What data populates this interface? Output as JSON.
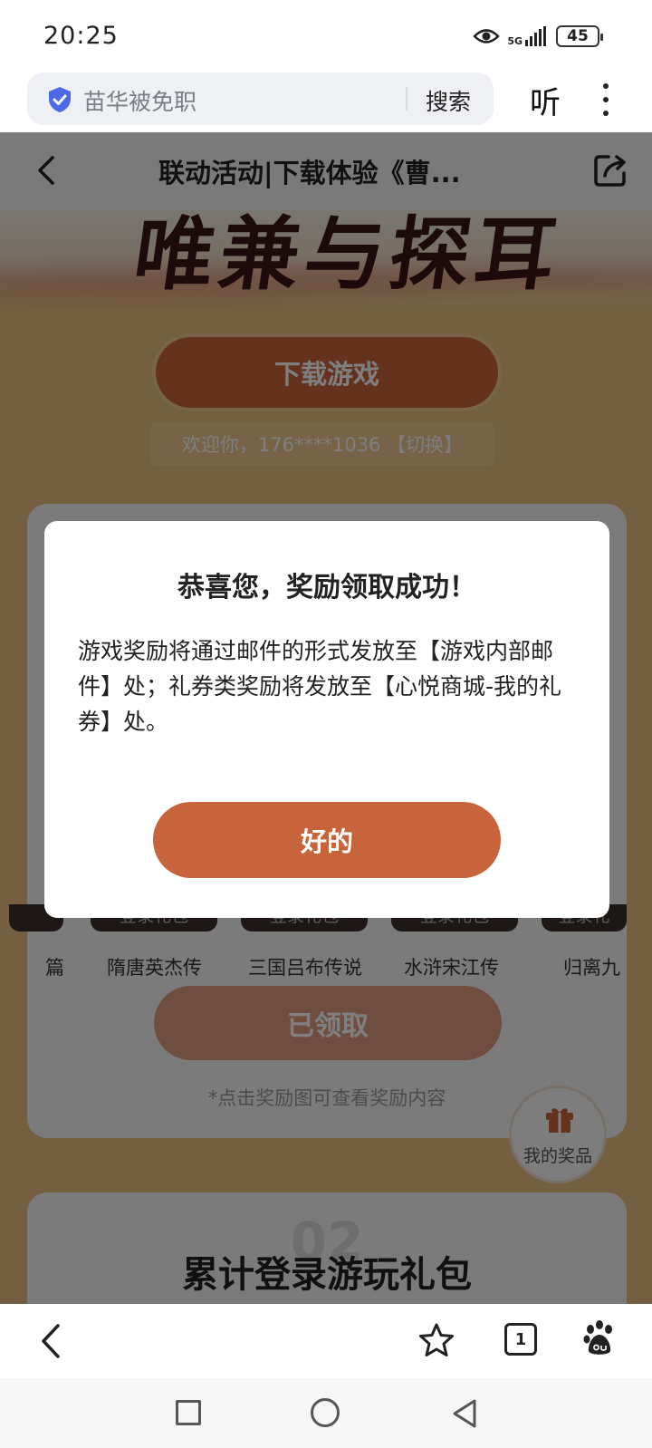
{
  "status_bar": {
    "time": "20:25",
    "network": "5G",
    "battery": "45"
  },
  "browser": {
    "search_query": "苗华被免职",
    "search_button": "搜索",
    "listen_button": "听"
  },
  "page": {
    "nav_title": "联动活动|下载体验《曹...",
    "banner_text": "唯兼与探耳",
    "download_button": "下载游戏",
    "welcome_text": "欢迎你，176****1036 【切换】",
    "games": [
      {
        "name": "篇",
        "thumb_label": ""
      },
      {
        "name": "隋唐英杰传",
        "thumb_label": "登录礼包"
      },
      {
        "name": "三国吕布传说",
        "thumb_label": "登录礼包"
      },
      {
        "name": "水浒宋江传",
        "thumb_label": "登录礼包"
      },
      {
        "name": "归离九",
        "thumb_label": "登录礼"
      }
    ],
    "claimed_button": "已领取",
    "hint": "*点击奖励图可查看奖励内容",
    "section2_number": "02",
    "section2_title": "累计登录游玩礼包",
    "prize_fab_label": "我的奖品"
  },
  "dialog": {
    "title": "恭喜您，奖励领取成功！",
    "body": "游戏奖励将通过邮件的形式发放至【游戏内部邮件】处；礼券类奖励将发放至【心悦商城-我的礼券】处。",
    "ok_button": "好的"
  },
  "toolbar": {
    "tab_count": "1"
  },
  "colors": {
    "accent": "#c8643b",
    "page_background": "#e9bf80"
  }
}
